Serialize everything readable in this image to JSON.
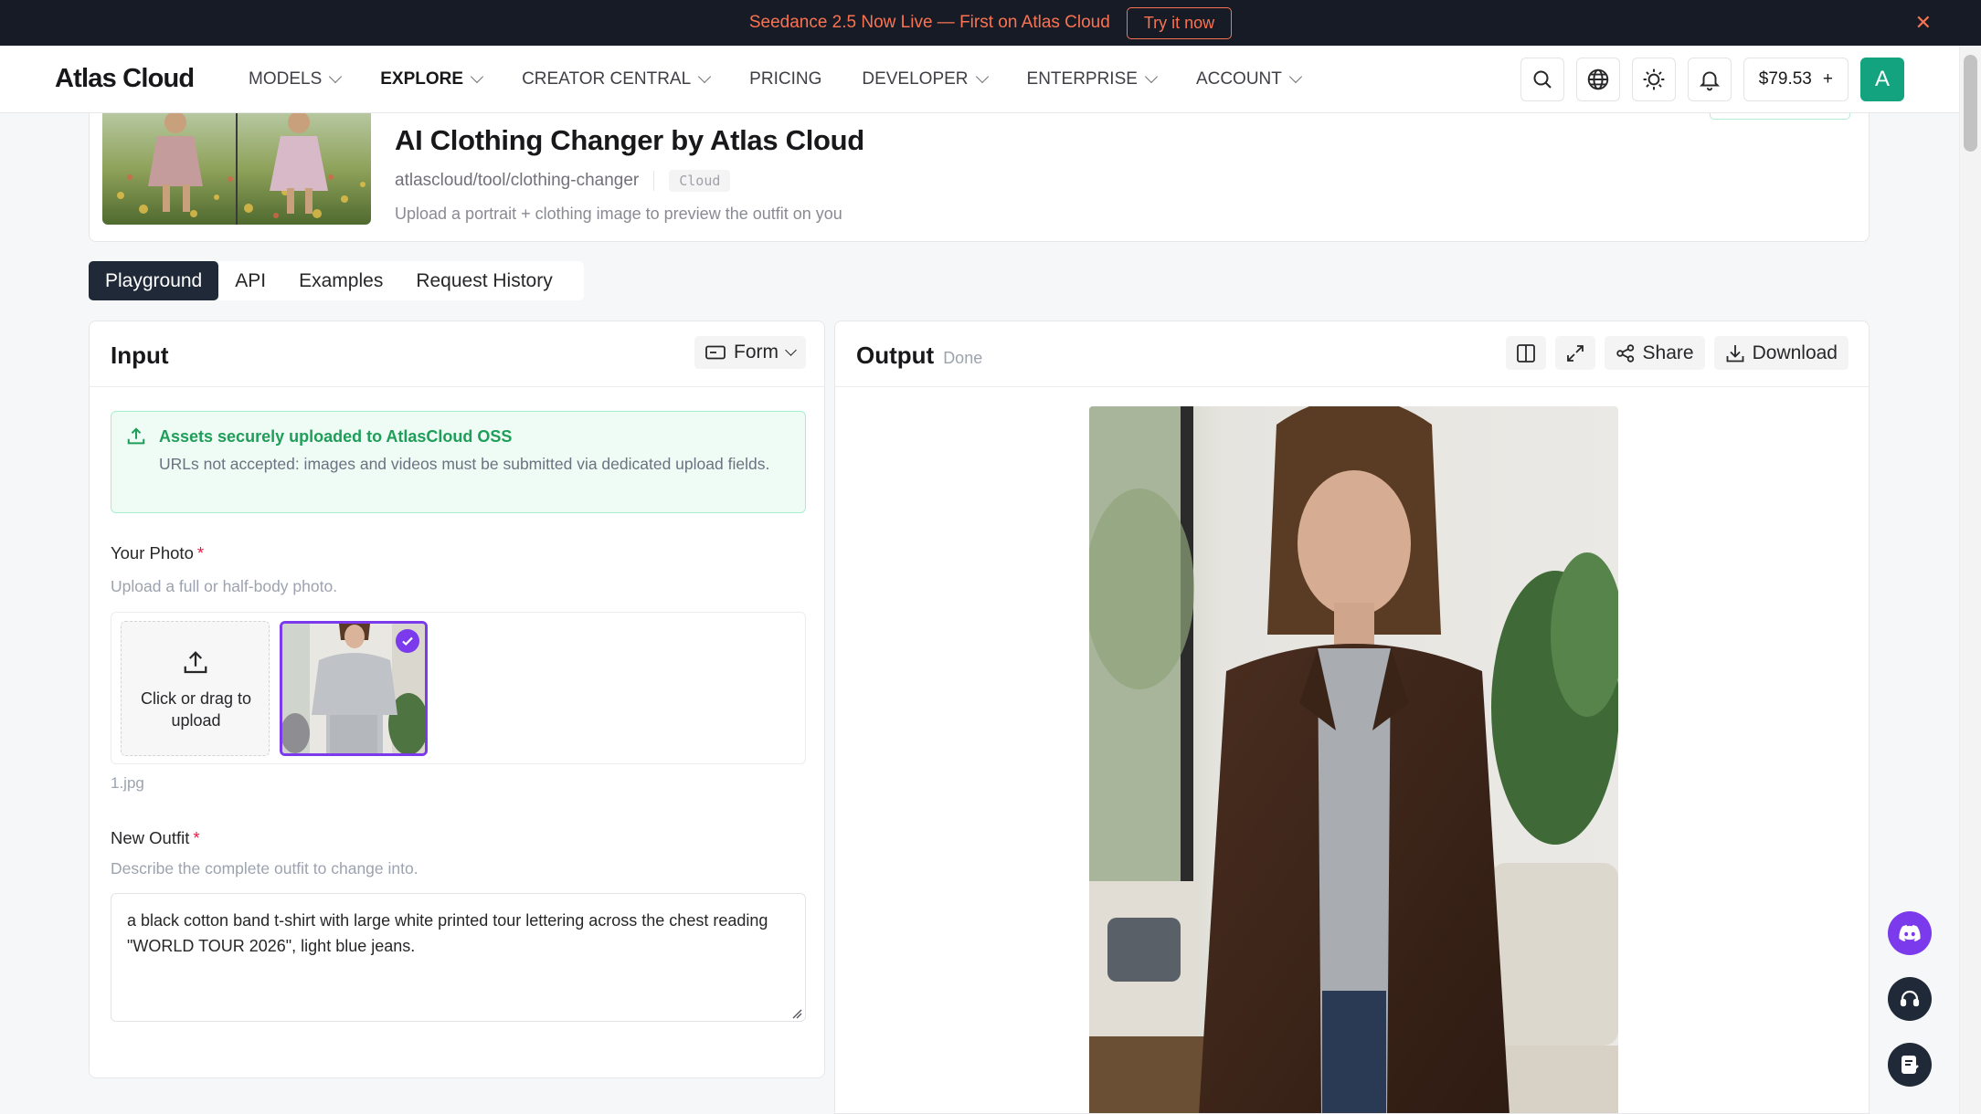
{
  "announcement": {
    "text": "Seedance 2.5 Now Live — First on Atlas Cloud",
    "cta": "Try it now",
    "close_icon": "close-icon"
  },
  "nav": {
    "logo": "Atlas Cloud",
    "items": [
      {
        "label": "MODELS",
        "dropdown": true,
        "active": false
      },
      {
        "label": "EXPLORE",
        "dropdown": true,
        "active": true
      },
      {
        "label": "CREATOR CENTRAL",
        "dropdown": true,
        "active": false
      },
      {
        "label": "PRICING",
        "dropdown": false,
        "active": false
      },
      {
        "label": "DEVELOPER",
        "dropdown": true,
        "active": false
      },
      {
        "label": "ENTERPRISE",
        "dropdown": true,
        "active": false
      },
      {
        "label": "ACCOUNT",
        "dropdown": true,
        "active": false
      }
    ],
    "icons": [
      "search-icon",
      "globe-icon",
      "sun-icon",
      "bell-icon"
    ],
    "balance": "$79.53",
    "balance_add": "+",
    "avatar_letter": "A",
    "avatar_color": "#14a37f"
  },
  "model": {
    "title": "AI Clothing Changer by Atlas Cloud",
    "path": "atlascloud/tool/clothing-changer",
    "badge": "Cloud",
    "description": "Upload a portrait + clothing image to preview the outfit on you"
  },
  "tabs": [
    {
      "label": "Playground",
      "active": true
    },
    {
      "label": "API",
      "active": false
    },
    {
      "label": "Examples",
      "active": false
    },
    {
      "label": "Request History",
      "active": false
    }
  ],
  "input_panel": {
    "title": "Input",
    "mode_button": "Form",
    "notice": {
      "title": "Assets securely uploaded to AtlasCloud OSS",
      "text": "URLs not accepted: images and videos must be submitted via dedicated upload fields."
    },
    "photo_field": {
      "label": "Your Photo",
      "required_mark": "*",
      "help": "Upload a full or half-body photo.",
      "upload_text": "Click or drag to upload",
      "file_name": "1.jpg"
    },
    "outfit_field": {
      "label": "New Outfit",
      "required_mark": "*",
      "help": "Describe the complete outfit to change into.",
      "value": "a black cotton band t-shirt with large white printed tour lettering across the chest reading \"WORLD TOUR 2026\", light blue jeans."
    }
  },
  "output_panel": {
    "title": "Output",
    "status": "Done",
    "actions": {
      "compare_icon": "columns-icon",
      "expand_icon": "expand-icon",
      "share": "Share",
      "download": "Download"
    }
  },
  "floating_buttons": [
    "discord-icon",
    "headset-icon",
    "feedback-icon"
  ],
  "colors": {
    "accent": "#7c3aed",
    "announcement_text": "#f97352",
    "success": "#1e9e58"
  }
}
